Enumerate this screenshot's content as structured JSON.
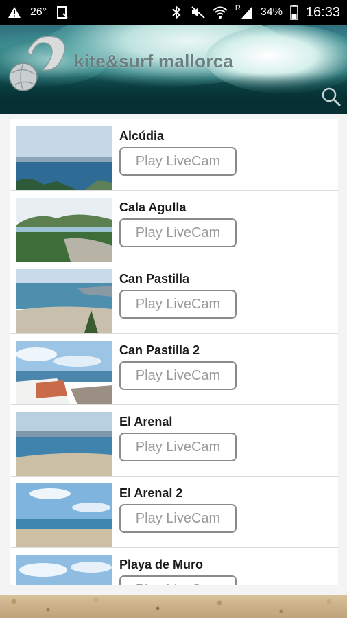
{
  "status_bar": {
    "temperature": "26°",
    "battery": "34%",
    "time": "16:33",
    "network_badge": "R",
    "icons": [
      "warning-icon",
      "clipboard-icon",
      "bluetooth-icon",
      "mute-icon",
      "wifi-icon",
      "signal-icon",
      "battery-icon"
    ]
  },
  "header": {
    "title": "kite&surf mallorca",
    "search_icon": "search-icon"
  },
  "webcams": [
    {
      "name": "Alcúdia",
      "button": "Play LiveCam"
    },
    {
      "name": "Cala Agulla",
      "button": "Play LiveCam"
    },
    {
      "name": "Can Pastilla",
      "button": "Play LiveCam"
    },
    {
      "name": "Can Pastilla 2",
      "button": "Play LiveCam"
    },
    {
      "name": "El Arenal",
      "button": "Play LiveCam"
    },
    {
      "name": "El Arenal 2",
      "button": "Play LiveCam"
    },
    {
      "name": "Playa de Muro",
      "button": "Play LiveCam"
    }
  ],
  "colors": {
    "header_dark": "#062e31",
    "button_border": "#8a8a8a",
    "button_text": "#9a9a9a"
  }
}
